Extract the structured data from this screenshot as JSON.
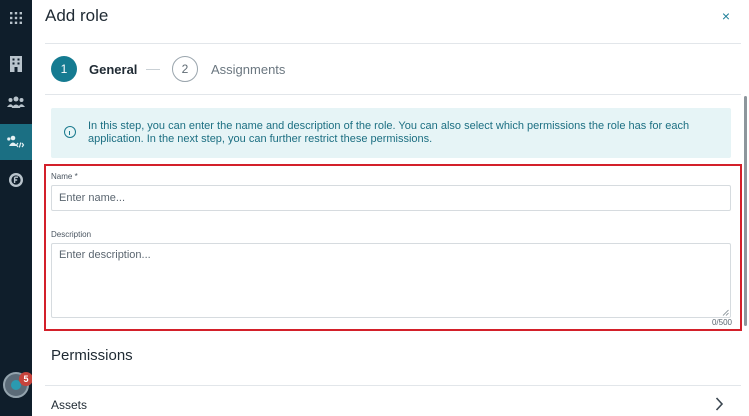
{
  "rail": {
    "items": [
      {
        "icon": "grid-apps-icon"
      },
      {
        "icon": "building-icon"
      },
      {
        "icon": "users-icon"
      },
      {
        "icon": "users-code-icon",
        "active": true
      },
      {
        "icon": "circle-f-icon"
      }
    ],
    "notification_count": "5"
  },
  "dialog": {
    "title": "Add role",
    "close_label": "×",
    "steps": [
      {
        "number": "1",
        "label": "General",
        "active": true
      },
      {
        "number": "2",
        "label": "Assignments",
        "active": false
      }
    ],
    "info_text": "In this step, you can enter the name and description of the role. You can also select which permissions the role has for each application. In the next step, you can further restrict these permissions.",
    "name_field": {
      "label": "Name *",
      "placeholder": "Enter name...",
      "value": ""
    },
    "description_field": {
      "label": "Description",
      "placeholder": "Enter description...",
      "value": "",
      "counter": "0/500"
    },
    "permissions": {
      "title": "Permissions",
      "rows": [
        {
          "label": "Assets"
        }
      ]
    }
  },
  "colors": {
    "accent": "#157b91",
    "highlight": "#d3202a",
    "rail_bg": "#0f1e2b",
    "info_bg": "#e6f4f6"
  }
}
